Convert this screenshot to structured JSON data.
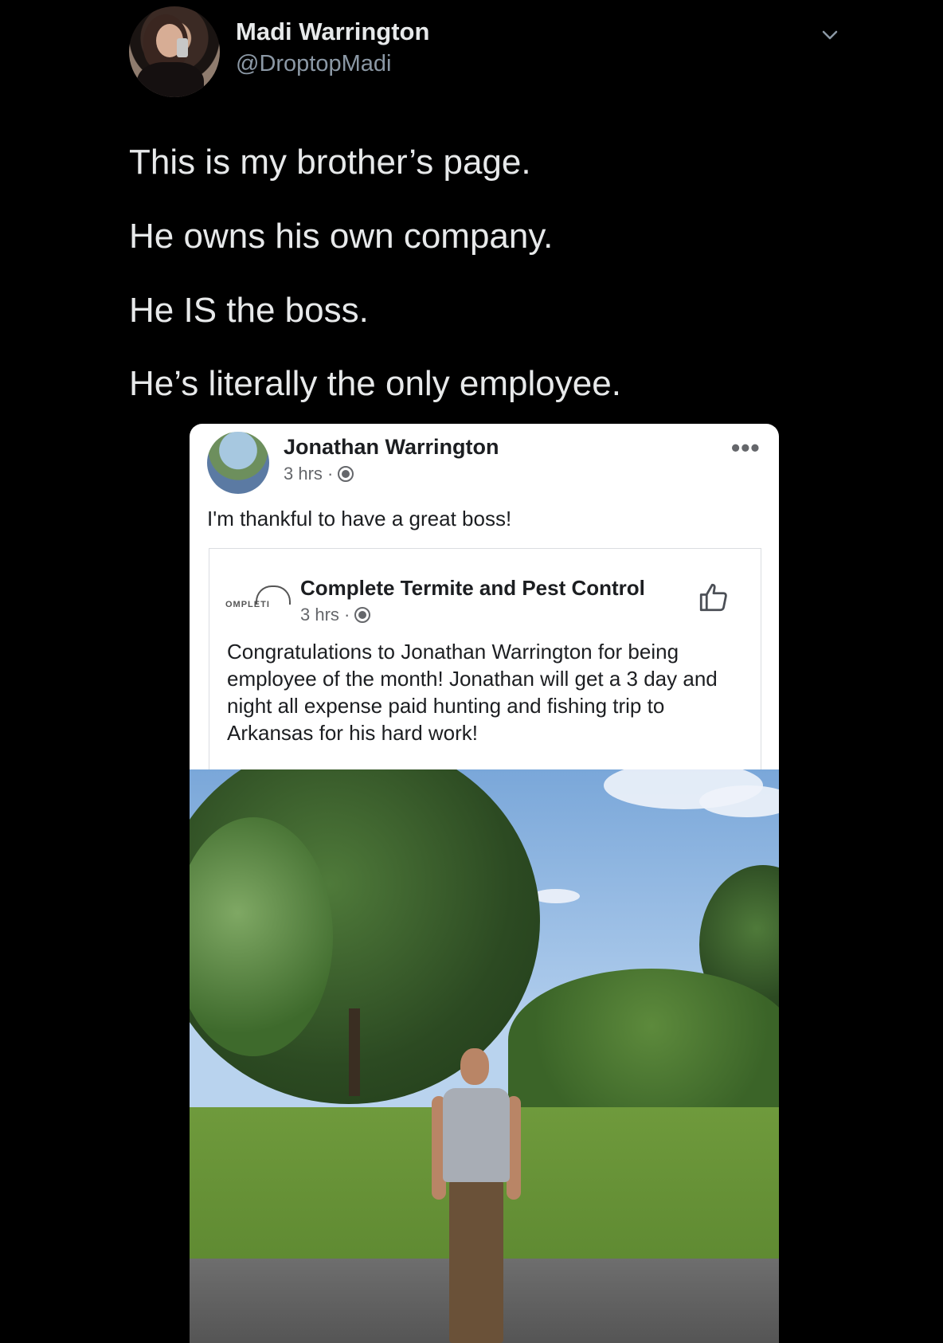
{
  "tweet": {
    "author_name": "Madi Warrington",
    "author_handle": "@DroptopMadi",
    "lines": [
      "This is my brother’s page.",
      "He owns his own company.",
      "He IS the boss.",
      "He’s literally the only employee."
    ]
  },
  "fb_post": {
    "author": "Jonathan Warrington",
    "time": "3 hrs · ",
    "text": "I'm thankful to have a great boss!",
    "shared": {
      "logo_text": "OMPLETI",
      "author": "Complete Termite and Pest Control",
      "time": "3 hrs · ",
      "text": "Congratulations to Jonathan Warrington for being employee of the month! Jonathan will get a 3 day and night all expense paid hunting and fishing trip to Arkansas for his hard work!"
    }
  },
  "icons": {
    "chevron": "chevron-down-icon",
    "globe": "globe-icon",
    "more": "more-options-icon",
    "like": "like-icon"
  }
}
